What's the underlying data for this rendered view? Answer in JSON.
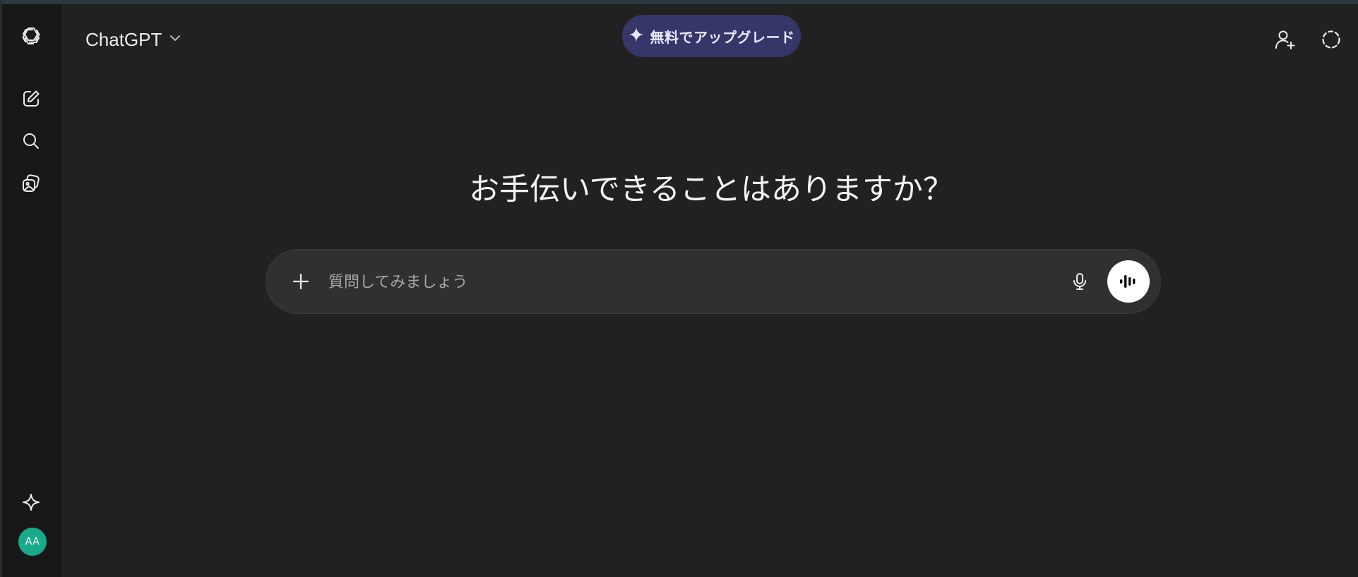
{
  "app": {
    "model_name": "ChatGPT"
  },
  "header": {
    "upgrade_label": "無料でアップグレード",
    "accent_color": "#373669"
  },
  "sidebar": {
    "items": [
      {
        "icon": "openai-logo-icon"
      },
      {
        "icon": "new-chat-icon"
      },
      {
        "icon": "search-icon"
      },
      {
        "icon": "library-images-icon"
      },
      {
        "icon": "sparkle-icon"
      }
    ],
    "avatar_initials": "AA",
    "avatar_color": "#19a98b"
  },
  "main": {
    "heading": "お手伝いできることはありますか？",
    "composer": {
      "placeholder": "質問してみましょう",
      "value": ""
    }
  }
}
